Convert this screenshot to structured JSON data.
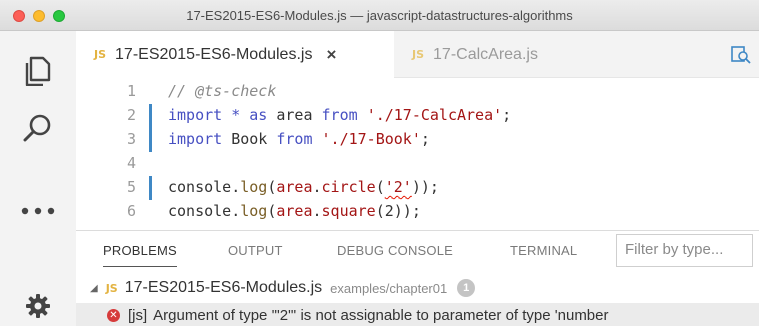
{
  "window": {
    "title": "17-ES2015-ES6-Modules.js — javascript-datastructures-algorithms"
  },
  "activity_bar": {
    "items": [
      "explorer-icon",
      "search-icon",
      "more-icon",
      "settings-icon"
    ]
  },
  "tabs": [
    {
      "badge": "JS",
      "label": "17-ES2015-ES6-Modules.js",
      "close": "×",
      "active": true
    },
    {
      "badge": "JS",
      "label": "17-CalcArea.js",
      "active": false
    }
  ],
  "editor": {
    "lines": [
      {
        "n": "1",
        "tokens": [
          {
            "t": "// @ts-check",
            "c": "c-comment"
          }
        ]
      },
      {
        "n": "2",
        "tokens": [
          {
            "t": "import",
            "c": "c-kw"
          },
          {
            "t": " * ",
            "c": "c-kw"
          },
          {
            "t": "as",
            "c": "c-kw"
          },
          {
            "t": " area ",
            "c": "c-dim"
          },
          {
            "t": "from",
            "c": "c-kw"
          },
          {
            "t": " ",
            "c": ""
          },
          {
            "t": "'./17-CalcArea'",
            "c": "c-str"
          },
          {
            "t": ";",
            "c": "c-dim"
          }
        ],
        "mark": true
      },
      {
        "n": "3",
        "tokens": [
          {
            "t": "import",
            "c": "c-kw"
          },
          {
            "t": " Book ",
            "c": "c-dim"
          },
          {
            "t": "from",
            "c": "c-kw"
          },
          {
            "t": " ",
            "c": ""
          },
          {
            "t": "'./17-Book'",
            "c": "c-str"
          },
          {
            "t": ";",
            "c": "c-dim"
          }
        ],
        "mark": true
      },
      {
        "n": "4",
        "tokens": []
      },
      {
        "n": "5",
        "tokens": [
          {
            "t": "console",
            "c": "c-dim"
          },
          {
            "t": ".",
            "c": "c-dim"
          },
          {
            "t": "log",
            "c": "c-fn"
          },
          {
            "t": "(",
            "c": "c-dim"
          },
          {
            "t": "area",
            "c": "c-str"
          },
          {
            "t": ".",
            "c": "c-dim"
          },
          {
            "t": "circle",
            "c": "c-str"
          },
          {
            "t": "(",
            "c": "c-dim"
          },
          {
            "t": "'2'",
            "c": "c-str squiggle"
          },
          {
            "t": "));",
            "c": "c-dim"
          }
        ],
        "mark": true
      },
      {
        "n": "6",
        "tokens": [
          {
            "t": "console",
            "c": "c-dim"
          },
          {
            "t": ".",
            "c": "c-dim"
          },
          {
            "t": "log",
            "c": "c-fn"
          },
          {
            "t": "(",
            "c": "c-dim"
          },
          {
            "t": "area",
            "c": "c-str"
          },
          {
            "t": ".",
            "c": "c-dim"
          },
          {
            "t": "square",
            "c": "c-str"
          },
          {
            "t": "(2));",
            "c": "c-dim"
          }
        ]
      }
    ]
  },
  "panel": {
    "tabs": [
      "PROBLEMS",
      "OUTPUT",
      "DEBUG CONSOLE",
      "TERMINAL"
    ],
    "filter_placeholder": "Filter by type...",
    "file": {
      "badge": "JS",
      "name": "17-ES2015-ES6-Modules.js",
      "path": "examples/chapter01",
      "count": "1"
    },
    "problem": {
      "source": "[js]",
      "message": "Argument of type '\"2\"' is not assignable to parameter of type 'number"
    }
  },
  "colors": {
    "accent": "#3f88c5",
    "error": "#d63b3b",
    "js_badge": "#e3b341"
  }
}
